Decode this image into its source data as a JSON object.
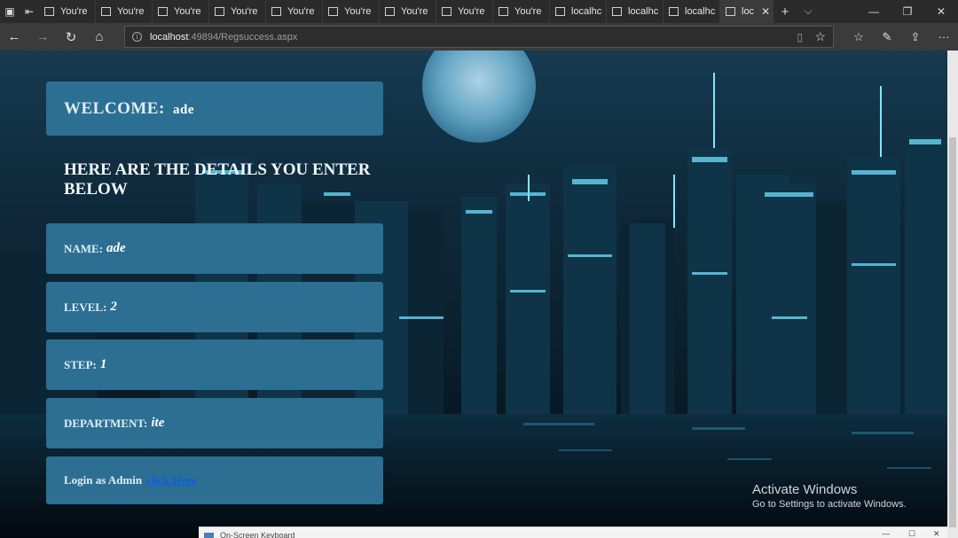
{
  "browser": {
    "tabs": [
      {
        "label": "You're"
      },
      {
        "label": "You're"
      },
      {
        "label": "You're"
      },
      {
        "label": "You're"
      },
      {
        "label": "You're"
      },
      {
        "label": "You're"
      },
      {
        "label": "You're"
      },
      {
        "label": "You're"
      },
      {
        "label": "You're"
      },
      {
        "label": "localhc"
      },
      {
        "label": "localhc"
      },
      {
        "label": "localhc"
      }
    ],
    "active_tab": {
      "label": "loc"
    },
    "url_host": "localhost",
    "url_rest": ":49894/Regsuccess.aspx"
  },
  "page": {
    "welcome_label": "WELCOME:",
    "username": "ade",
    "details_heading": "HERE ARE THE DETAILS YOU ENTER BELOW",
    "fields": [
      {
        "label": "NAME:",
        "value": "ade"
      },
      {
        "label": "LEVEL:",
        "value": "2"
      },
      {
        "label": "STEP:",
        "value": "1"
      },
      {
        "label": "DEPARTMENT:",
        "value": "ite"
      }
    ],
    "admin_text": "Login as Admin",
    "admin_link": "click Here"
  },
  "watermark": {
    "title": "Activate Windows",
    "subtitle": "Go to Settings to activate Windows."
  },
  "taskbar_window": {
    "title": "On-Screen Keyboard"
  },
  "colors": {
    "panel": "#2c6f93",
    "link": "#0b5fe0",
    "chrome_dark": "#2b2b2b"
  }
}
